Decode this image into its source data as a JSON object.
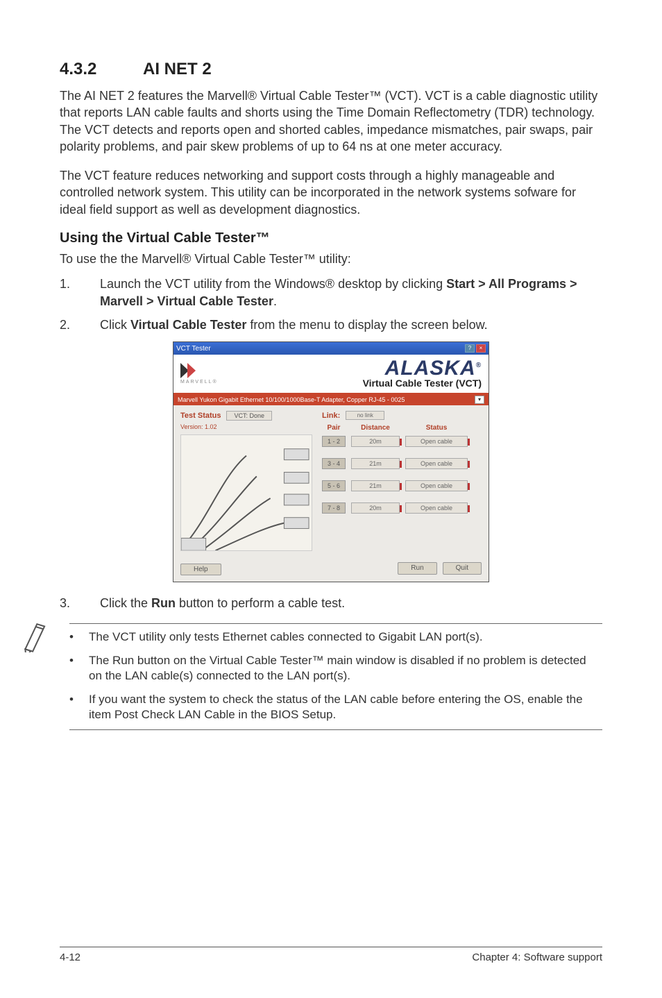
{
  "section": {
    "number": "4.3.2",
    "title": "AI NET 2"
  },
  "para1": "The AI NET 2 features the Marvell® Virtual Cable Tester™ (VCT). VCT is a cable diagnostic utility that reports LAN cable faults and shorts using the Time Domain Reflectometry (TDR) technology. The VCT detects and reports open and shorted cables, impedance mismatches, pair swaps, pair polarity problems, and pair skew problems of up to 64 ns at one meter accuracy.",
  "para2": "The VCT feature reduces networking and support costs through a highly manageable and controlled network system. This utility can be incorporated in the network systems sofware for ideal field support as well as development diagnostics.",
  "subhead": "Using the Virtual Cable Tester™",
  "para3": "To use the the Marvell® Virtual Cable Tester™ utility:",
  "steps": [
    {
      "n": "1.",
      "pre": "Launch the VCT utility from the Windows® desktop by clicking ",
      "bold": "Start > All Programs > Marvell > Virtual Cable Tester",
      "post": "."
    },
    {
      "n": "2.",
      "pre": "Click ",
      "bold": "Virtual Cable Tester",
      "post": " from the menu to display the screen below."
    }
  ],
  "screenshot": {
    "titlebar": "VCT Tester",
    "brand": "MARVELL®",
    "alaska": "ALASKA",
    "alaska_r": "®",
    "subtitle": "Virtual Cable Tester (VCT)",
    "band": "Marvell Yukon Gigabit Ethernet 10/100/1000Base-T Adapter, Copper RJ-45 - 0025",
    "left": {
      "test_status_label": "Test Status",
      "test_status_btn": "VCT: Done",
      "version": "Version: 1.02"
    },
    "right": {
      "link_label": "Link:",
      "link_val": "no link",
      "col_pair": "Pair",
      "col_dist": "Distance",
      "col_stat": "Status",
      "rows": [
        {
          "pair": "1 - 2",
          "dist": "20m",
          "stat": "Open cable"
        },
        {
          "pair": "3 - 4",
          "dist": "21m",
          "stat": "Open cable"
        },
        {
          "pair": "5 - 6",
          "dist": "21m",
          "stat": "Open cable"
        },
        {
          "pair": "7 - 8",
          "dist": "20m",
          "stat": "Open cable"
        }
      ]
    },
    "buttons": {
      "help": "Help",
      "run": "Run",
      "quit": "Quit"
    }
  },
  "step3": {
    "n": "3.",
    "pre": "Click the ",
    "bold": "Run",
    "post": " button to perform a cable test."
  },
  "notes": [
    "The VCT utility only tests Ethernet cables connected to Gigabit LAN port(s).",
    "The Run button on the Virtual Cable Tester™ main window is disabled if no problem is detected on the LAN cable(s) connected to the LAN port(s).",
    "If you want the system to check the status of the LAN cable before entering the OS, enable the item Post Check LAN Cable in the BIOS Setup."
  ],
  "footer": {
    "left": "4-12",
    "right": "Chapter 4: Software support"
  }
}
